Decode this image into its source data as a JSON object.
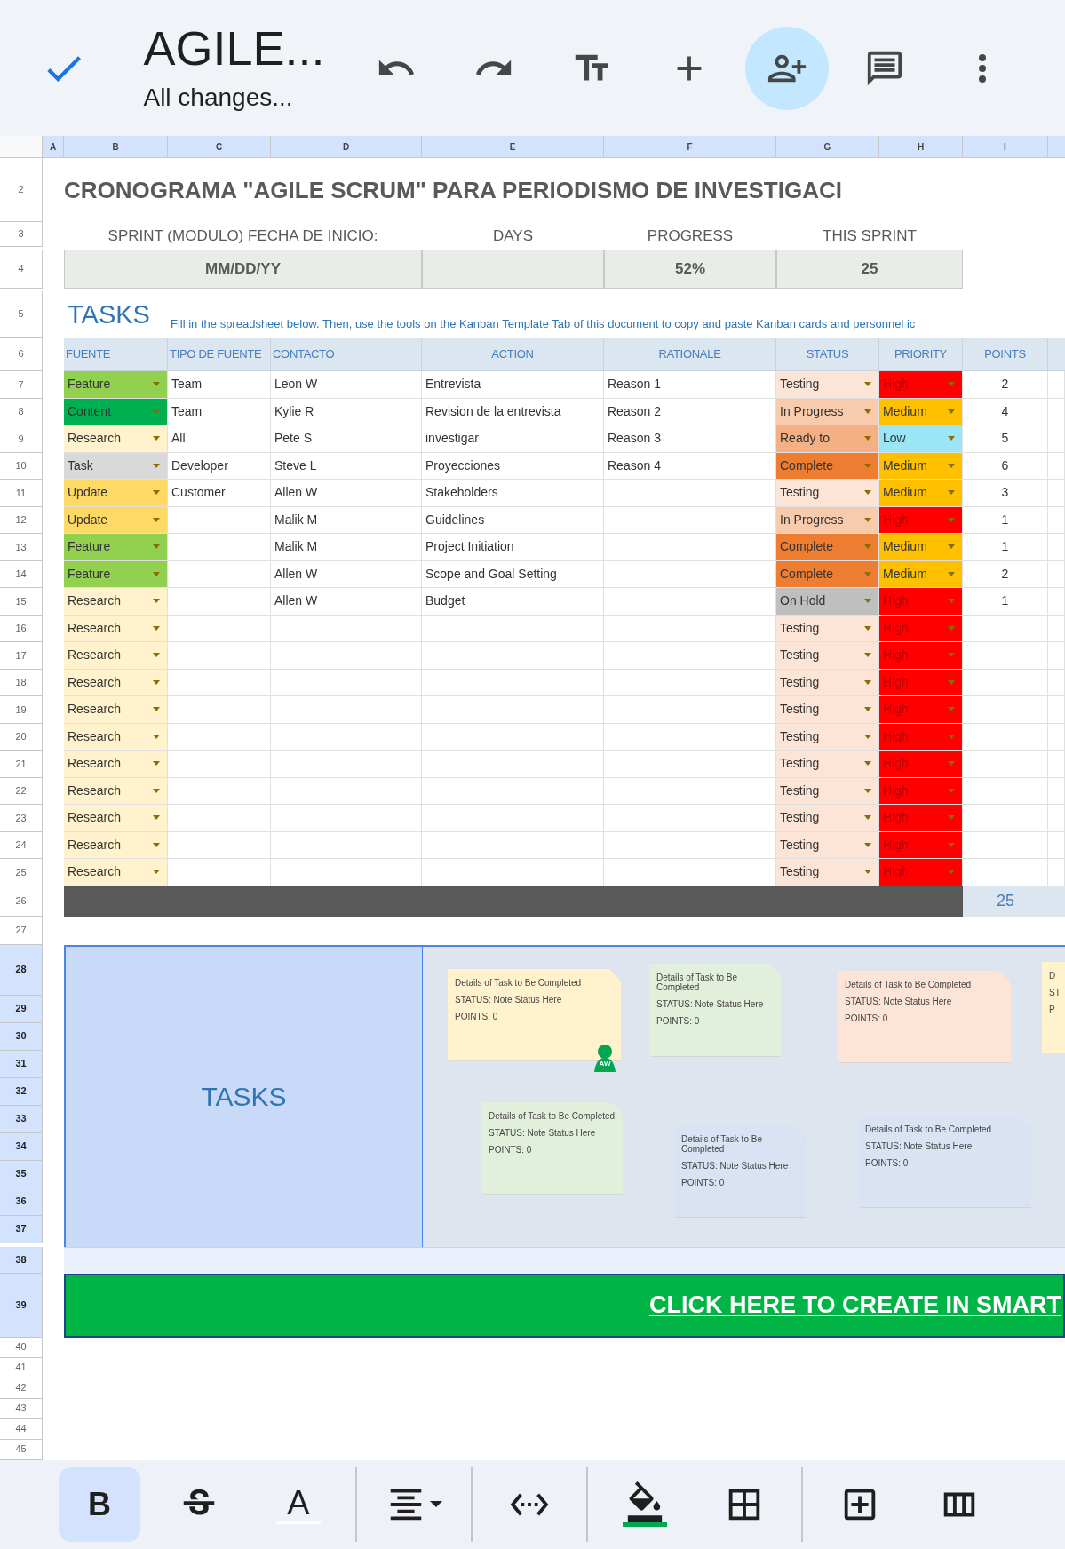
{
  "top_bar": {
    "title": "AGILE...",
    "subtitle": "All changes...",
    "actions": [
      {
        "kind": "undo",
        "selected": false
      },
      {
        "kind": "redo",
        "selected": false
      },
      {
        "kind": "text_format",
        "selected": false
      },
      {
        "kind": "insert",
        "selected": false
      },
      {
        "kind": "share",
        "selected": true
      },
      {
        "kind": "comments",
        "selected": false
      },
      {
        "kind": "more",
        "selected": false
      }
    ]
  },
  "sheet": {
    "columns": [
      "A",
      "B",
      "C",
      "D",
      "E",
      "F",
      "G",
      "H",
      "I"
    ],
    "title": {
      "row": "2",
      "text": "CRONOGRAMA \"AGILE SCRUM\" PARA PERIODISMO DE INVESTIGACI"
    },
    "summary": {
      "rows": [
        "3",
        "4"
      ],
      "items": [
        {
          "label": "SPRINT (MODULO) FECHA DE INICIO:",
          "value": "MM/DD/YY"
        },
        {
          "label": "DAYS"
        },
        {
          "label": "PROGRESS",
          "value": "52%"
        },
        {
          "label": "THIS SPRINT",
          "value": "25"
        }
      ]
    },
    "tasks_section": {
      "row": "5",
      "heading": "TASKS",
      "instructions": "Fill in the spreadsheet below. Then, use the tools on the Kanban Template Tab of this document to copy and paste Kanban cards and personnel ic"
    },
    "table": {
      "row": "6",
      "columns": [
        "FUENTE",
        "TIPO DE FUENTE",
        "CONTACTO",
        "ACTION",
        "RATIONALE",
        "STATUS",
        "PRIORITY",
        "POINTS"
      ],
      "rows": [
        {
          "row": "7",
          "fuente": {
            "label": "Feature",
            "color": "#92d050"
          },
          "tipo": "Team",
          "contacto": "Leon W",
          "action": "Entrevista",
          "rationale": "Reason 1",
          "status": {
            "label": "Testing",
            "color": "#fce4d6"
          },
          "priority": {
            "label": "High",
            "color": "#ff0000"
          },
          "points": "2"
        },
        {
          "row": "8",
          "fuente": {
            "label": "Content",
            "color": "#00b050"
          },
          "tipo": "Team",
          "contacto": "Kylie R",
          "action": "Revision de la entrevista",
          "rationale": "Reason 2",
          "status": {
            "label": "In Progress",
            "color": "#f8cbad"
          },
          "priority": {
            "label": "Medium",
            "color": "#ffc000"
          },
          "points": "4"
        },
        {
          "row": "9",
          "fuente": {
            "label": "Research",
            "color": "#fff2cc"
          },
          "tipo": "All",
          "contacto": "Pete S",
          "action": "investigar",
          "rationale": "Reason 3",
          "status": {
            "label": "Ready to",
            "color": "#f4b084"
          },
          "priority": {
            "label": "Low",
            "color": "#9ae6f7"
          },
          "points": "5"
        },
        {
          "row": "10",
          "fuente": {
            "label": "Task",
            "color": "#d9d9d9"
          },
          "tipo": "Developer",
          "contacto": "Steve L",
          "action": "Proyecciones",
          "rationale": "Reason 4",
          "status": {
            "label": "Complete",
            "color": "#ed7d31"
          },
          "priority": {
            "label": "Medium",
            "color": "#ffc000"
          },
          "points": "6"
        },
        {
          "row": "11",
          "fuente": {
            "label": "Update",
            "color": "#ffd966"
          },
          "tipo": "Customer",
          "contacto": "Allen W",
          "action": "Stakeholders",
          "status": {
            "label": "Testing",
            "color": "#fce4d6"
          },
          "priority": {
            "label": "Medium",
            "color": "#ffc000"
          },
          "points": "3"
        },
        {
          "row": "12",
          "fuente": {
            "label": "Update",
            "color": "#ffd966"
          },
          "contacto": "Malik M",
          "action": "Guidelines",
          "status": {
            "label": "In Progress",
            "color": "#f8cbad"
          },
          "priority": {
            "label": "High",
            "color": "#ff0000"
          },
          "points": "1"
        },
        {
          "row": "13",
          "fuente": {
            "label": "Feature",
            "color": "#92d050"
          },
          "contacto": "Malik M",
          "action": "Project Initiation",
          "status": {
            "label": "Complete",
            "color": "#ed7d31"
          },
          "priority": {
            "label": "Medium",
            "color": "#ffc000"
          },
          "points": "1"
        },
        {
          "row": "14",
          "fuente": {
            "label": "Feature",
            "color": "#92d050"
          },
          "contacto": "Allen W",
          "action": "Scope and Goal Setting",
          "status": {
            "label": "Complete",
            "color": "#ed7d31"
          },
          "priority": {
            "label": "Medium",
            "color": "#ffc000"
          },
          "points": "2"
        },
        {
          "row": "15",
          "fuente": {
            "label": "Research",
            "color": "#fff2cc"
          },
          "contacto": "Allen W",
          "action": "Budget",
          "status": {
            "label": "On Hold",
            "color": "#bfbfbf"
          },
          "priority": {
            "label": "High",
            "color": "#ff0000"
          },
          "points": "1"
        },
        {
          "row": "16",
          "fuente": {
            "label": "Research",
            "color": "#fff2cc"
          },
          "status": {
            "label": "Testing",
            "color": "#fce4d6"
          },
          "priority": {
            "label": "High",
            "color": "#ff0000"
          }
        },
        {
          "row": "17",
          "fuente": {
            "label": "Research",
            "color": "#fff2cc"
          },
          "status": {
            "label": "Testing",
            "color": "#fce4d6"
          },
          "priority": {
            "label": "High",
            "color": "#ff0000"
          }
        },
        {
          "row": "18",
          "fuente": {
            "label": "Research",
            "color": "#fff2cc"
          },
          "status": {
            "label": "Testing",
            "color": "#fce4d6"
          },
          "priority": {
            "label": "High",
            "color": "#ff0000"
          }
        },
        {
          "row": "19",
          "fuente": {
            "label": "Research",
            "color": "#fff2cc"
          },
          "status": {
            "label": "Testing",
            "color": "#fce4d6"
          },
          "priority": {
            "label": "High",
            "color": "#ff0000"
          }
        },
        {
          "row": "20",
          "fuente": {
            "label": "Research",
            "color": "#fff2cc"
          },
          "status": {
            "label": "Testing",
            "color": "#fce4d6"
          },
          "priority": {
            "label": "High",
            "color": "#ff0000"
          }
        },
        {
          "row": "21",
          "fuente": {
            "label": "Research",
            "color": "#fff2cc"
          },
          "status": {
            "label": "Testing",
            "color": "#fce4d6"
          },
          "priority": {
            "label": "High",
            "color": "#ff0000"
          }
        },
        {
          "row": "22",
          "fuente": {
            "label": "Research",
            "color": "#fff2cc"
          },
          "status": {
            "label": "Testing",
            "color": "#fce4d6"
          },
          "priority": {
            "label": "High",
            "color": "#ff0000"
          }
        },
        {
          "row": "23",
          "fuente": {
            "label": "Research",
            "color": "#fff2cc"
          },
          "status": {
            "label": "Testing",
            "color": "#fce4d6"
          },
          "priority": {
            "label": "High",
            "color": "#ff0000"
          }
        },
        {
          "row": "24",
          "fuente": {
            "label": "Research",
            "color": "#fff2cc"
          },
          "status": {
            "label": "Testing",
            "color": "#fce4d6"
          },
          "priority": {
            "label": "High",
            "color": "#ff0000"
          }
        },
        {
          "row": "25",
          "fuente": {
            "label": "Research",
            "color": "#fff2cc"
          },
          "status": {
            "label": "Testing",
            "color": "#fce4d6"
          },
          "priority": {
            "label": "High",
            "color": "#ff0000"
          }
        }
      ],
      "total": {
        "row": "26",
        "value": "25"
      }
    },
    "gap_row": "27",
    "kanban": {
      "rows": [
        {
          "label": "28",
          "selected": true
        },
        {
          "label": "29",
          "selected": true
        },
        {
          "label": "30",
          "selected": true
        },
        {
          "label": "31",
          "selected": true
        },
        {
          "label": "32",
          "selected": true
        },
        {
          "label": "33",
          "selected": true
        },
        {
          "label": "34",
          "selected": true
        },
        {
          "label": "35",
          "selected": true
        },
        {
          "label": "36",
          "selected": true
        },
        {
          "label": "37",
          "selected": true
        }
      ],
      "label": "TASKS",
      "cards": [
        {
          "color": "#fff2cc",
          "lines": [
            "Details of Task to Be Completed",
            "STATUS: Note Status Here",
            "POINTS: 0"
          ],
          "assignee": "AW"
        },
        {
          "color": "#e2efda",
          "lines": [
            "Details of Task to Be Completed",
            "STATUS: Note Status Here",
            "POINTS: 0"
          ]
        },
        {
          "color": "#fce4d6",
          "lines": [
            "Details of Task to Be Completed",
            "STATUS: Note Status Here",
            "POINTS: 0"
          ]
        },
        {
          "color": "#fff2cc",
          "lines": [
            "D",
            "ST",
            "P"
          ]
        },
        {
          "color": "#e2efda",
          "lines": [
            "Details of Task to Be Completed",
            "STATUS: Note Status Here",
            "POINTS: 0"
          ]
        },
        {
          "color": "#dae3f3",
          "lines": [
            "Details of Task to Be Completed",
            "STATUS: Note Status Here",
            "POINTS: 0"
          ]
        },
        {
          "color": "#dae3f3",
          "lines": [
            "Details of Task to Be Completed",
            "STATUS: Note Status Here",
            "POINTS: 0"
          ]
        }
      ]
    },
    "band_row": {
      "label": "38",
      "selected": true
    },
    "banner": {
      "row": {
        "label": "39",
        "selected": true
      },
      "text": "CLICK HERE TO CREATE IN SMART"
    },
    "empty_rows": [
      "40",
      "41",
      "42",
      "43",
      "44",
      "45"
    ]
  },
  "bottom_toolbar": {
    "groups": [
      [
        {
          "kind": "bold",
          "label": "B",
          "selected": true
        },
        {
          "kind": "strikethrough",
          "selected": false
        },
        {
          "kind": "text_color",
          "label": "A",
          "selected": false
        }
      ],
      [
        {
          "kind": "align",
          "selected": false
        }
      ],
      [
        {
          "kind": "merge",
          "selected": false
        }
      ],
      [
        {
          "kind": "fill_color",
          "selected": false
        },
        {
          "kind": "borders",
          "selected": false
        }
      ],
      [
        {
          "kind": "insert_row",
          "selected": false
        },
        {
          "kind": "insert_column",
          "selected": false
        }
      ]
    ]
  }
}
